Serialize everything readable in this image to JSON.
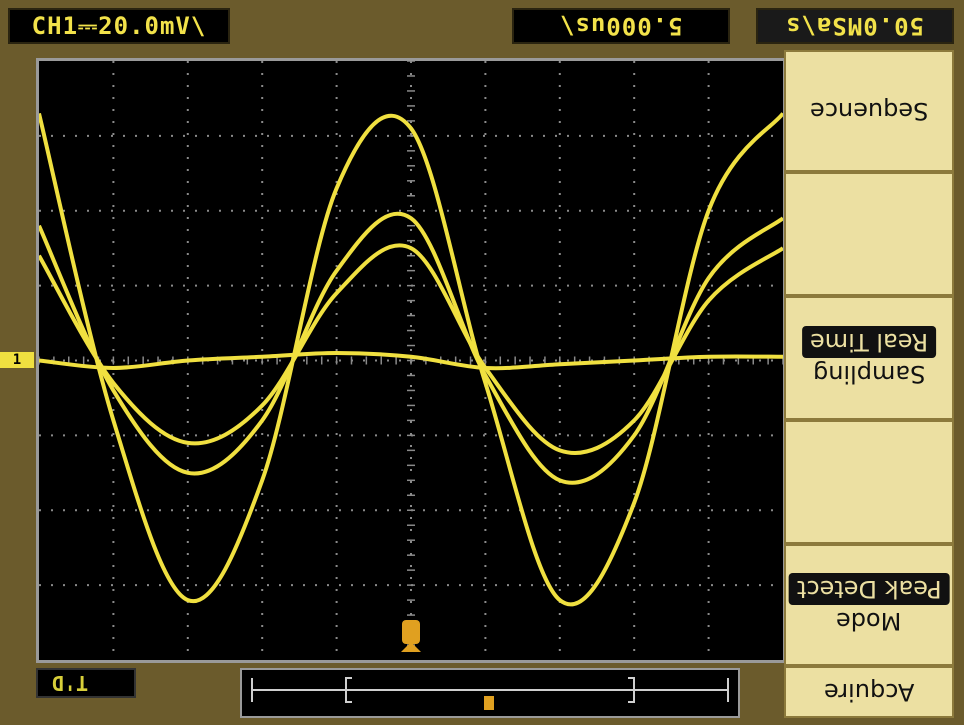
{
  "status": {
    "channel_scale": "CH1⎓20.0mV\\",
    "timebase": "5.000us\\",
    "sample_rate": "50.0MSa\\s"
  },
  "menu": {
    "mode_label": "Mode",
    "mode_value": "Peak Detect",
    "sampling_label": "Sampling",
    "sampling_value": "Real Time",
    "sequence_label": "Sequence",
    "acquire_label": "Acquire"
  },
  "trigger": {
    "state": "T'D"
  },
  "colors": {
    "trace": "#f0e040",
    "grid": "#8a8a8a",
    "trigger_marker": "#e0a020"
  },
  "icons": {
    "channel_marker": "ch1-level-marker-icon",
    "trigger_position": "trigger-position-icon"
  },
  "chart_data": {
    "type": "line",
    "title": "",
    "xlabel": "",
    "ylabel": "",
    "divisions_x": 10,
    "divisions_y": 8,
    "series": [
      {
        "x": [
          0,
          1,
          2,
          3,
          4,
          5,
          6,
          7,
          8,
          9,
          10
        ],
        "values": [
          3.3,
          -0.8,
          -3.2,
          -1.6,
          2.3,
          3.1,
          -0.3,
          -3.2,
          -1.9,
          2.0,
          3.3
        ]
      },
      {
        "x": [
          0,
          1,
          2,
          3,
          4,
          5,
          6,
          7,
          8,
          9,
          10
        ],
        "values": [
          1.8,
          -0.4,
          -1.5,
          -0.8,
          1.2,
          1.9,
          -0.2,
          -1.6,
          -1.0,
          1.1,
          1.9
        ]
      },
      {
        "x": [
          0,
          1,
          2,
          3,
          4,
          5,
          6,
          7,
          8,
          9,
          10
        ],
        "values": [
          1.4,
          -0.3,
          -1.1,
          -0.6,
          0.9,
          1.5,
          -0.1,
          -1.2,
          -0.8,
          0.8,
          1.5
        ]
      },
      {
        "x": [
          0,
          1,
          2,
          3,
          4,
          5,
          6,
          7,
          8,
          9,
          10
        ],
        "values": [
          0.0,
          -0.1,
          0.0,
          0.05,
          0.1,
          0.05,
          -0.1,
          -0.05,
          0.0,
          0.05,
          0.05
        ]
      }
    ]
  }
}
